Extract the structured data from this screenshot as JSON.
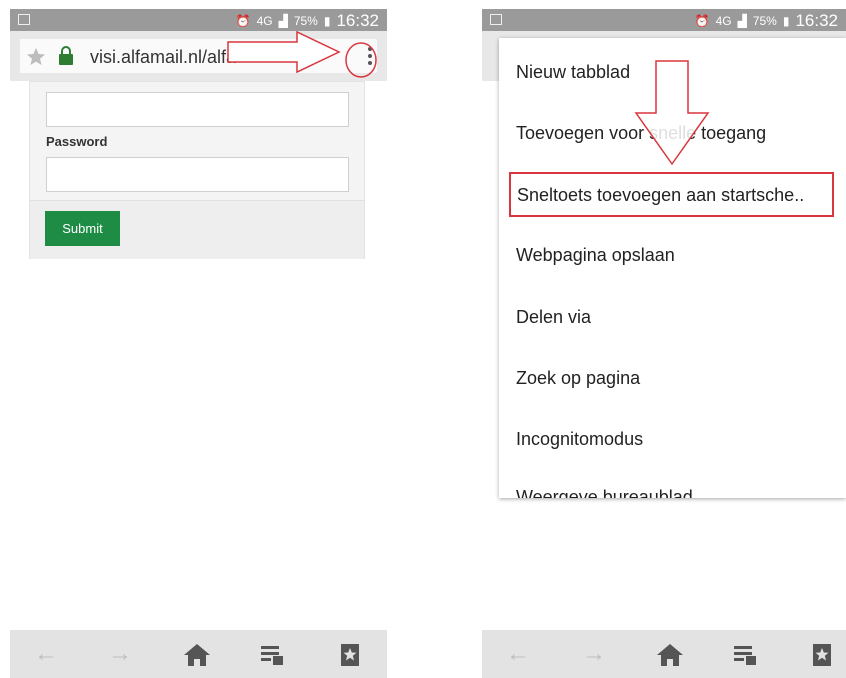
{
  "left": {
    "status_time": "16:32",
    "status_battery": "75%",
    "status_network": "4G",
    "url": "visi.alfamail.nl/alfa",
    "password_label": "Password",
    "submit_label": "Submit"
  },
  "right": {
    "status_time": "16:32",
    "status_battery": "75%",
    "status_network": "4G",
    "menu_items": [
      "Nieuw tabblad",
      "Toevoegen voor snelle toegang",
      "Sneltoets toevoegen aan startsche..",
      "Webpagina opslaan",
      "Delen via",
      "Zoek op pagina",
      "Incognitomodus",
      "Weergeve bureaublad"
    ]
  },
  "colors": {
    "annotation_red": "#d9363e",
    "submit_green": "#1e8c45",
    "status_gray": "#9a9a9a"
  },
  "icons": [
    "back-arrow-icon",
    "forward-arrow-icon",
    "home-icon",
    "tabs-icon",
    "bookmark-star-icon",
    "star-icon",
    "lock-icon",
    "overflow-menu-icon",
    "alarm-icon",
    "signal-icon",
    "battery-icon"
  ]
}
